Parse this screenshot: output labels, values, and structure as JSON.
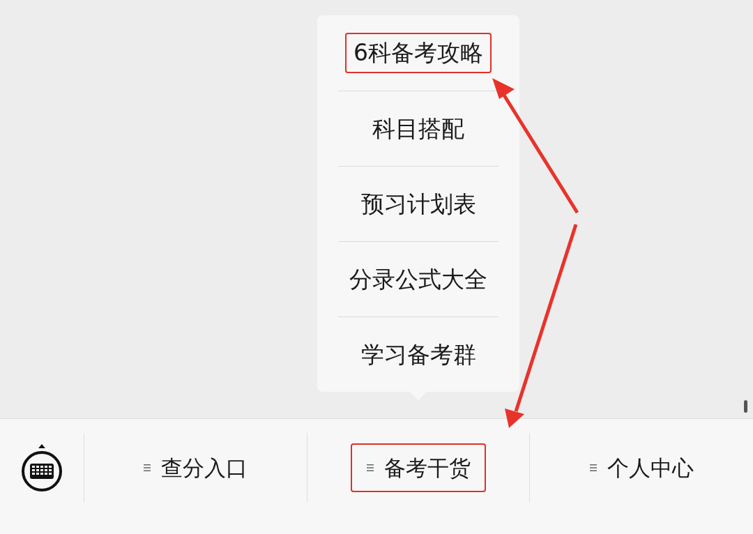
{
  "menu": {
    "items": [
      {
        "label": "6科备考攻略",
        "highlighted": true
      },
      {
        "label": "科目搭配",
        "highlighted": false
      },
      {
        "label": "预习计划表",
        "highlighted": false
      },
      {
        "label": "分录公式大全",
        "highlighted": false
      },
      {
        "label": "学习备考群",
        "highlighted": false
      }
    ]
  },
  "tabs": [
    {
      "label": "查分入口",
      "highlighted": false
    },
    {
      "label": "备考干货",
      "highlighted": true
    },
    {
      "label": "个人中心",
      "highlighted": false
    }
  ]
}
